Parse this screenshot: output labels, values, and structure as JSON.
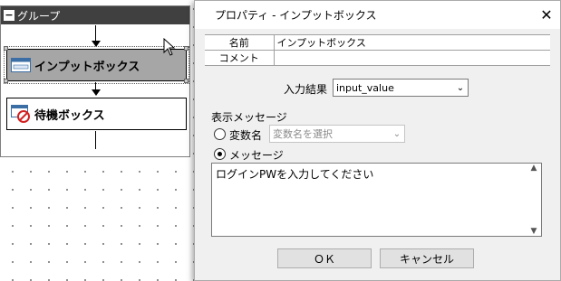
{
  "canvas": {
    "group_label": "グループ",
    "collapse_symbol": "−",
    "nodes": [
      {
        "label": "インプットボックス",
        "icon": "input-box-icon",
        "selected": true
      },
      {
        "label": "待機ボックス",
        "icon": "wait-box-icon",
        "selected": false
      }
    ]
  },
  "dialog": {
    "title": "プロパティ - インプットボックス",
    "close_symbol": "✕",
    "properties": [
      {
        "key": "名前",
        "value": "インプットボックス"
      },
      {
        "key": "コメント",
        "value": ""
      }
    ],
    "input_result_label": "入力結果",
    "input_result_value": "input_value",
    "display_message_label": "表示メッセージ",
    "variable_radio_label": "変数名",
    "variable_select_placeholder": "変数名を選択",
    "message_radio_label": "メッセージ",
    "message_text": "ログインPWを入力してください",
    "selected_option": "message",
    "ok_label": "ＯＫ",
    "cancel_label": "キャンセル"
  },
  "colors": {
    "group_header": "#404040",
    "selected_node": "#a6a6a6",
    "dialog_bg": "#f0f0f0"
  }
}
